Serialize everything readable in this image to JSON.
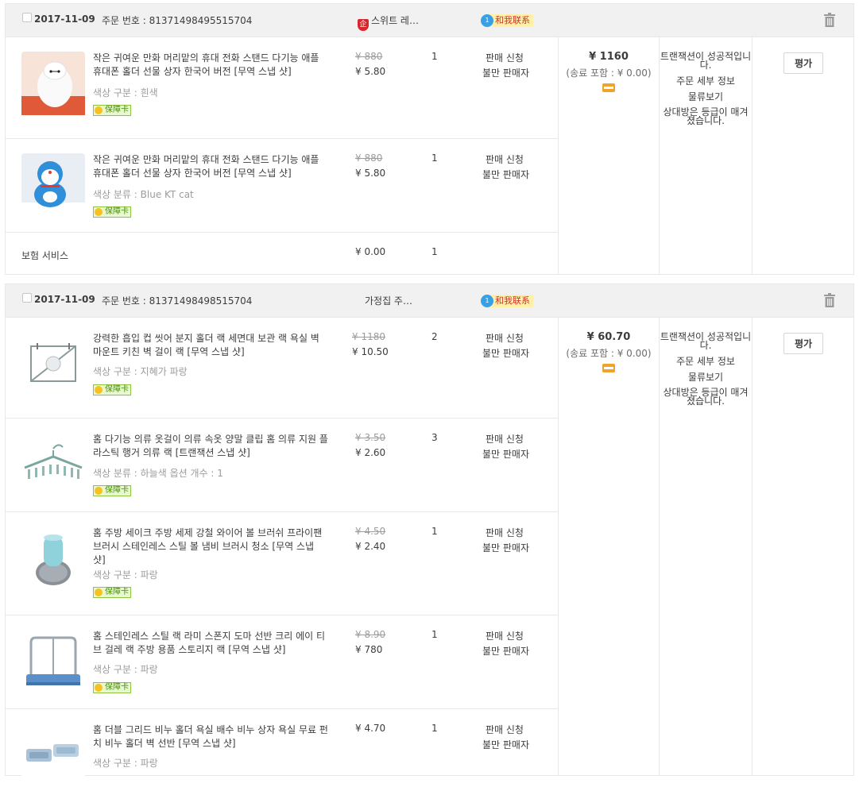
{
  "orders": [
    {
      "date": "2017-11-09",
      "order_no": "주문 번호 : 81371498495515704",
      "shop": "스위트 레…",
      "contact": "和我联系",
      "total": "¥ 1160",
      "shipping": "(송료 포함 : ¥ 0.00)",
      "status": "트랜잭션이 성공적입니다.",
      "detail": "주문 세부 정보",
      "logistics": "물류보기",
      "rated": "상대방은 등급이 매겨졌습니다.",
      "rate_button": "평가",
      "items": [
        {
          "title": "작은 귀여운 만화 머리맡의 휴대 전화 스탠드 다기능 애플 휴대폰 홀더 선물 상자 한국어 버전 [무역 스냅 샷]",
          "spec": "색상 구분 : 흰색",
          "guarantee": "保障卡",
          "orig_price": "¥ 880",
          "price": "¥ 5.80",
          "qty": "1",
          "action1": "판매 신청",
          "action2": "불만 판매자"
        },
        {
          "title": "작은 귀여운 만화 머리맡의 휴대 전화 스탠드 다기능 애플 휴대폰 홀더 선물 상자 한국어 버전 [무역 스냅 샷]",
          "spec": "색상 분류 : Blue KT cat",
          "guarantee": "保障卡",
          "orig_price": "¥ 880",
          "price": "¥ 5.80",
          "qty": "1",
          "action1": "판매 신청",
          "action2": "불만 판매자"
        }
      ],
      "insurance": {
        "label": "보험 서비스",
        "price": "¥ 0.00",
        "qty": "1"
      }
    },
    {
      "date": "2017-11-09",
      "order_no": "주문 번호 : 81371498498515704",
      "shop": "가정집 주…",
      "contact": "和我联系",
      "total": "¥ 60.70",
      "shipping": "(송료 포함 : ¥ 0.00)",
      "status": "트랜잭션이 성공적입니다.",
      "detail": "주문 세부 정보",
      "logistics": "물류보기",
      "rated": "상대방은 등급이 매겨졌습니다.",
      "rate_button": "평가",
      "items": [
        {
          "title": "강력한 흡입 컵 씻어 분지 홀더 랙 세면대 보관 랙 욕실 벽 마운트 키친 벽 걸이 랙 [무역 스냅 샷]",
          "spec": "색상 구분 : 지혜가 파랑",
          "guarantee": "保障卡",
          "orig_price": "¥ 1180",
          "price": "¥ 10.50",
          "qty": "2",
          "action1": "판매 신청",
          "action2": "불만 판매자"
        },
        {
          "title": "홈 다기능 의류 옷걸이 의류 속옷 양말 클립 홈 의류 지원 플라스틱 행거 의류 랙 [트랜잭션 스냅 샷]",
          "spec": "색상 분류 : 하늘색    옵션 개수 : 1",
          "guarantee": "保障卡",
          "orig_price": "¥ 3.50",
          "price": "¥ 2.60",
          "qty": "3",
          "action1": "판매 신청",
          "action2": "불만 판매자"
        },
        {
          "title": "홈 주방 세이크 주방 세제 강철 와이어 볼 브러쉬 프라이팬 브러시 스테인레스 스틸 볼 냄비 브러시 청소 [무역 스냅 샷]",
          "spec": "색상 구분 : 파랑",
          "guarantee": "保障卡",
          "orig_price": "¥ 4.50",
          "price": "¥ 2.40",
          "qty": "1",
          "action1": "판매 신청",
          "action2": "불만 판매자"
        },
        {
          "title": "홈 스테인레스 스틸 랙 라미 스폰지 도마 선반 크리 에이 티브 걸레 랙 주방 용품 스토리지 랙 [무역 스냅 샷]",
          "spec": "색상 구분 : 파랑",
          "guarantee": "保障卡",
          "orig_price": "¥ 8.90",
          "price": "¥ 780",
          "qty": "1",
          "action1": "판매 신청",
          "action2": "불만 판매자"
        },
        {
          "title": "홈 더블 그리드 비누 홀더 욕실 배수 비누 상자 욕실 무료 펀치 비누 홀더 벽 선반 [무역 스냅 샷]",
          "spec": "색상 구분 : 파랑",
          "guarantee": "",
          "orig_price": "",
          "price": "¥ 4.70",
          "qty": "1",
          "action1": "판매 신청",
          "action2": "불만 판매자"
        }
      ]
    }
  ]
}
